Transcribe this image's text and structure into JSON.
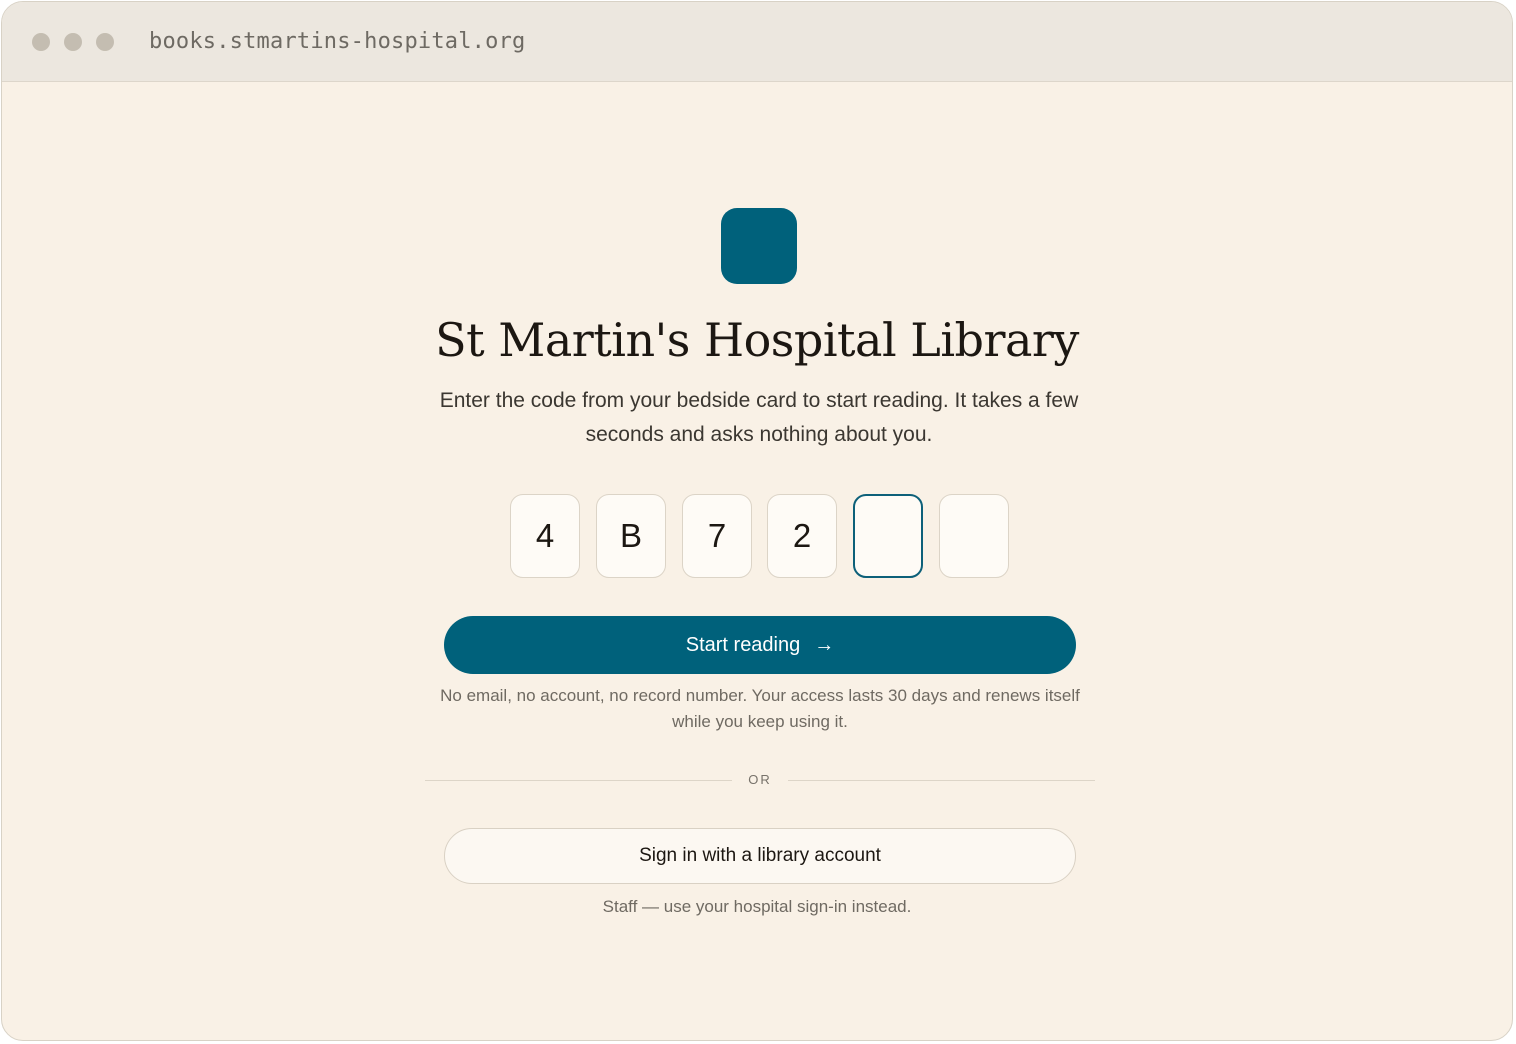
{
  "browser": {
    "url": "books.stmartins-hospital.org"
  },
  "colors": {
    "accent": "#00617b",
    "background": "#f9f1e6",
    "titlebar": "#ece7df"
  },
  "header": {
    "logo_icon": "library-logo-icon",
    "title": "St Martin's Hospital Library",
    "subtitle": "Enter the code from your bedside card to start reading. It takes a few seconds and asks nothing about you."
  },
  "code": {
    "digits": [
      "4",
      "B",
      "7",
      "2",
      "",
      ""
    ],
    "active_index": 4
  },
  "actions": {
    "start_label": "Start reading",
    "start_icon": "arrow-right-icon",
    "start_arrow": "→",
    "privacy_note": "No email, no account, no record number. Your access lasts 30 days and renews itself while you keep using it.",
    "divider_label": "OR",
    "signin_label": "Sign in with a library account",
    "staff_note": "Staff — use your hospital sign-in instead."
  }
}
